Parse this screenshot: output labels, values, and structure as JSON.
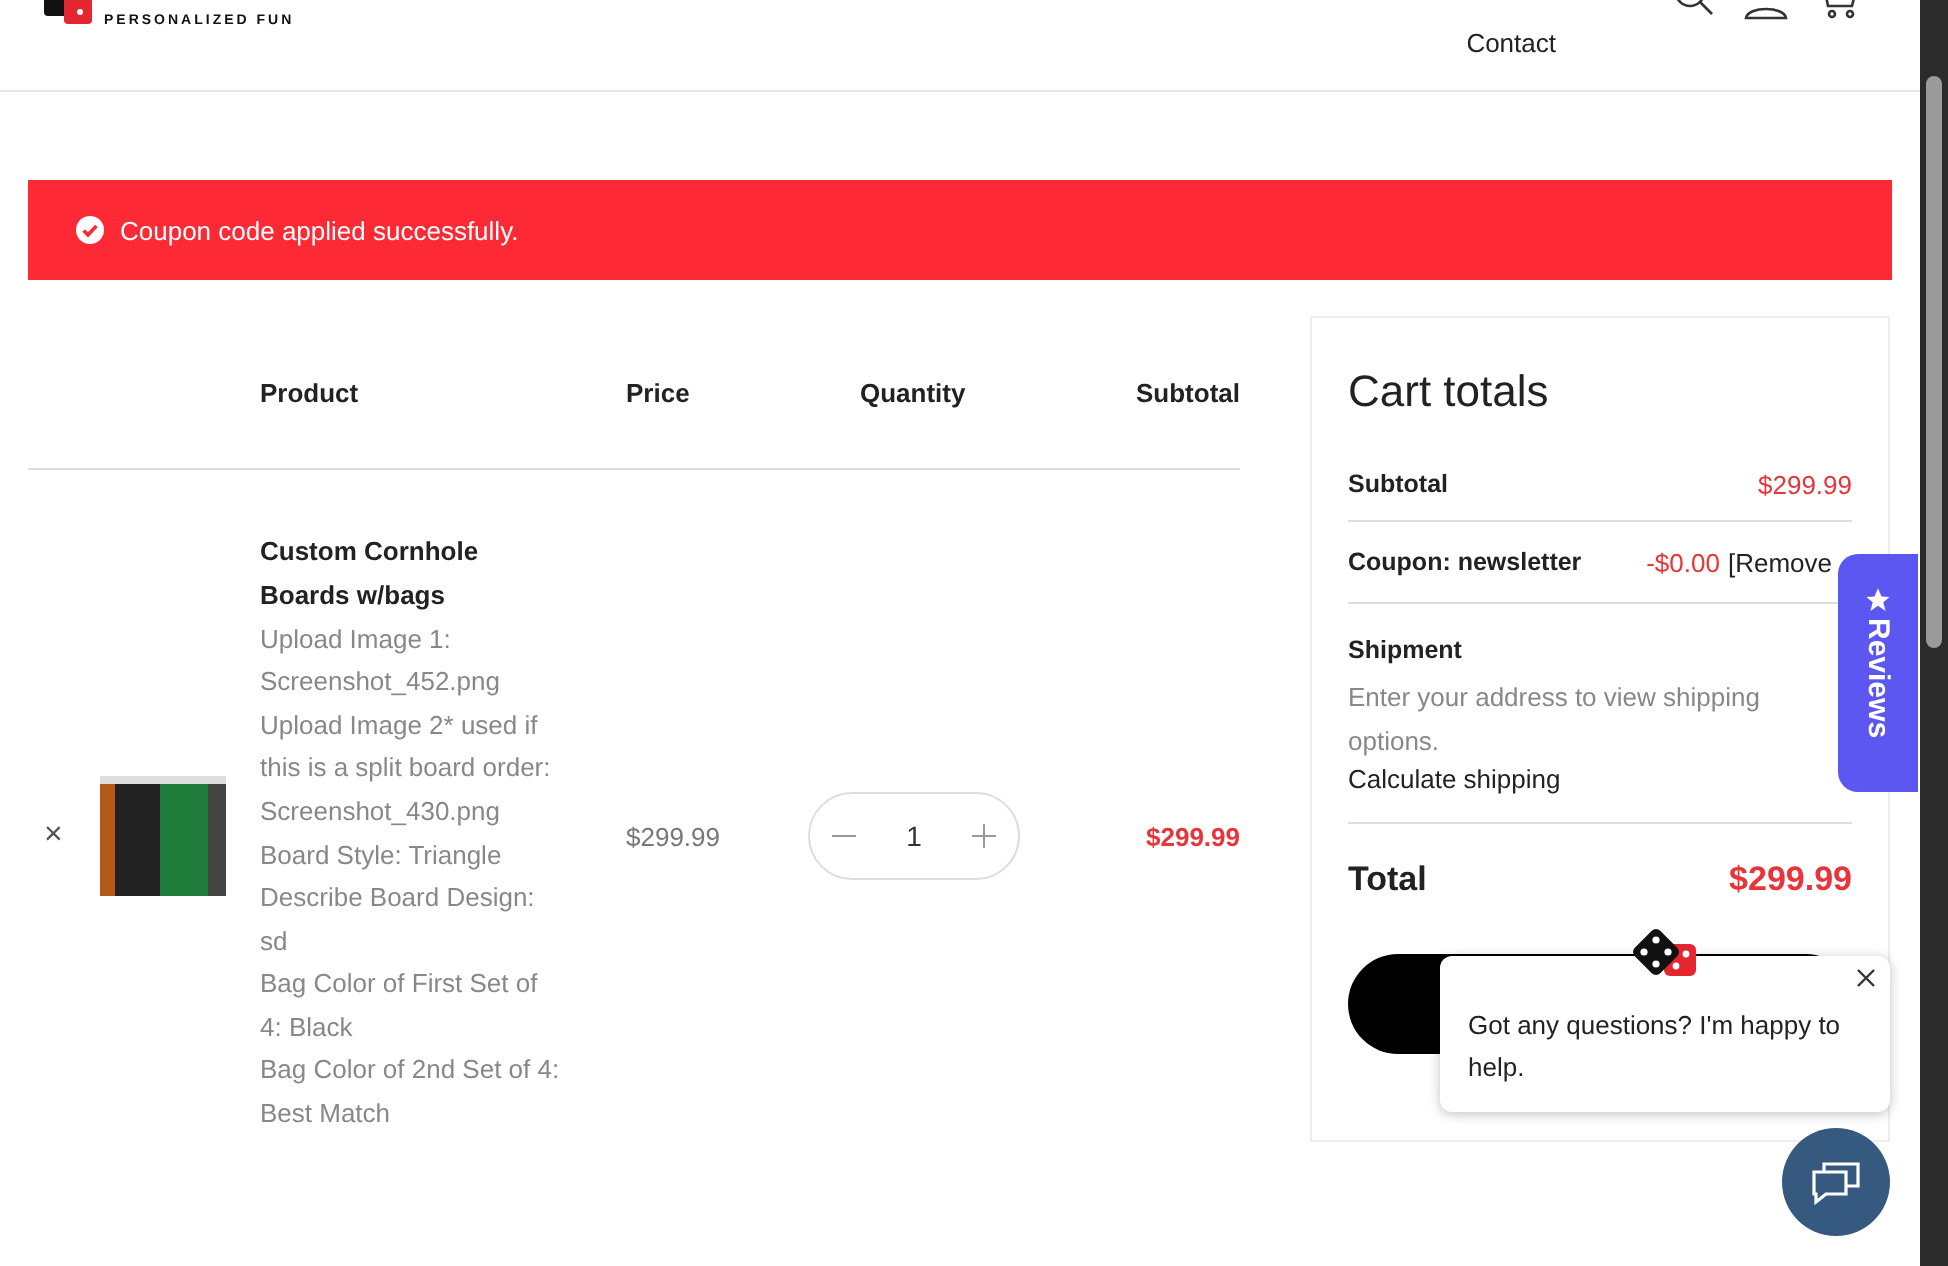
{
  "header": {
    "logo_tagline": "PERSONALIZED FUN",
    "nav": [
      "Contact"
    ]
  },
  "alert": {
    "message": "Coupon code applied successfully."
  },
  "table": {
    "columns": [
      "Product",
      "Price",
      "Quantity",
      "Subtotal"
    ],
    "rows": [
      {
        "remove": "×",
        "name": "Custom Cornhole Boards w/bags",
        "options": [
          {
            "label": "Upload Image 1:",
            "value": "Screenshot_452.png"
          },
          {
            "label": "Upload Image 2* used if this is a split board order:",
            "value": "Screenshot_430.png"
          },
          {
            "label": "Board Style:",
            "value": "Triangle"
          },
          {
            "label": "Describe Board Design:",
            "value": "sd"
          },
          {
            "label": "Bag Color of First Set of 4:",
            "value": "Black"
          },
          {
            "label": "Bag Color of 2nd Set of 4:",
            "value": "Best Match"
          }
        ],
        "price": "$299.99",
        "quantity": "1",
        "subtotal": "$299.99"
      }
    ]
  },
  "cart_totals": {
    "title": "Cart totals",
    "subtotal_label": "Subtotal",
    "subtotal": "$299.99",
    "coupon_label": "Coupon: newsletter",
    "coupon_amount": "-$0.00",
    "coupon_remove": "[Remove",
    "shipment_label": "Shipment",
    "shipment_note": "Enter your address to view shipping options.",
    "calculate_shipping": "Calculate shipping",
    "total_label": "Total",
    "total": "$299.99"
  },
  "reviews_tab": {
    "label": "Reviews"
  },
  "chat_popup": {
    "message": "Got any questions? I'm happy to help."
  }
}
